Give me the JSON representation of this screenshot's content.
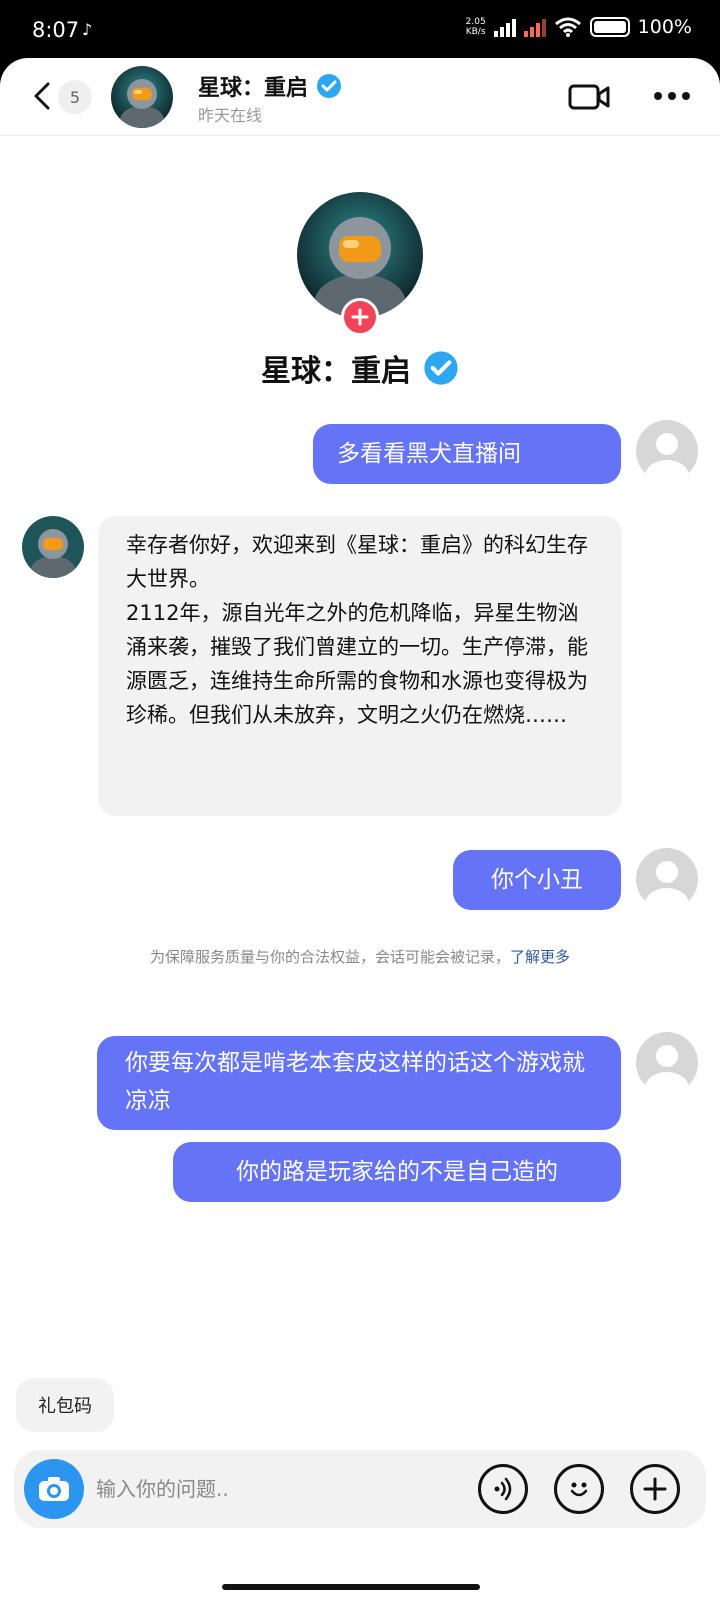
{
  "status_bar": {
    "time": "8:07",
    "net_speed_value": "2.05",
    "net_speed_unit": "KB/s",
    "battery": "100%",
    "sim_label": "6"
  },
  "header": {
    "unread_count": "5",
    "name": "星球：重启",
    "status": "昨天在线"
  },
  "profile": {
    "name": "星球：重启"
  },
  "messages": [
    {
      "from": "user",
      "text": "多看看黑犬直播间"
    },
    {
      "from": "bot",
      "text": "幸存者你好，欢迎来到《星球：重启》的科幻生存大世界。\n2112年，源自光年之外的危机降临，异星生物汹涌来袭，摧毁了我们曾建立的一切。生产停滞，能源匮乏，连维持生命所需的食物和水源也变得极为珍稀。但我们从未放弃，文明之火仍在燃烧……"
    },
    {
      "from": "user",
      "text": "你个小丑"
    },
    {
      "from": "user",
      "text": "你要每次都是啃老本套皮这样的话这个游戏就凉凉"
    },
    {
      "from": "user",
      "text": "你的路是玩家给的不是自己造的"
    }
  ],
  "notice": {
    "text": "为保障服务质量与你的合法权益，会话可能会被记录，",
    "link": "了解更多"
  },
  "quick_reply": {
    "chip": "礼包码"
  },
  "composer": {
    "placeholder": "输入你的问题.."
  },
  "colors": {
    "outgoing_bubble": "#6573f6",
    "incoming_bubble": "#f2f2f2",
    "verified": "#2ea7f2",
    "follow": "#f3435b",
    "camera": "#2b95f0"
  },
  "icons": [
    "back-icon",
    "verified-icon",
    "video-call-icon",
    "more-icon",
    "plus-icon",
    "camera-icon",
    "voice-icon",
    "emoji-icon",
    "add-icon"
  ]
}
